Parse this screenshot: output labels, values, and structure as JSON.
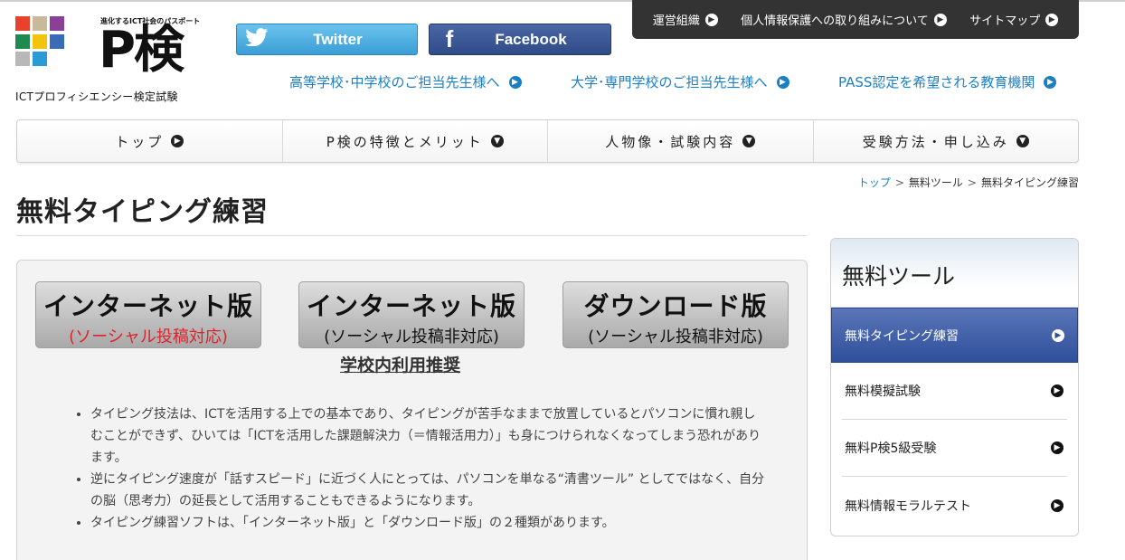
{
  "logo": {
    "tagline": "進化するICT社会のパスポート",
    "main": "P検",
    "subtitle": "ICTプロフィシエンシー検定試験",
    "mosaic_colors": [
      "#e8432a",
      "#c9b99a",
      "#8b3f96",
      "#1e8a4f",
      "#f2c40f",
      "#3a6bb5",
      "#b8b8b8",
      "#2a9bd6",
      "#ffffff"
    ]
  },
  "social": {
    "twitter": "Twitter",
    "facebook": "Facebook"
  },
  "utility_nav": [
    {
      "label": "運営組織"
    },
    {
      "label": "個人情報保護への取り組みについて"
    },
    {
      "label": "サイトマップ"
    }
  ],
  "teacher_links": [
    {
      "label": "高等学校･中学校のご担当先生様へ"
    },
    {
      "label": "大学･専門学校のご担当先生様へ"
    },
    {
      "label": "PASS認定を希望される教育機関"
    }
  ],
  "main_nav": [
    {
      "label": "トップ"
    },
    {
      "label": "P検の特徴とメリット"
    },
    {
      "label": "人物像・試験内容"
    },
    {
      "label": "受験方法・申し込み"
    }
  ],
  "breadcrumb": {
    "home": "トップ",
    "section": "無料ツール",
    "current": "無料タイピング練習",
    "separator": ">"
  },
  "page": {
    "title": "無料タイピング練習"
  },
  "versions": [
    {
      "line1": "インターネット版",
      "line2": "(ソーシャル投稿対応)",
      "line2_color": "#e0222a"
    },
    {
      "line1": "インターネット版",
      "line2": "(ソーシャル投稿非対応)",
      "line2_color": "#111111"
    },
    {
      "line1": "ダウンロード版",
      "line2": "(ソーシャル投稿非対応)",
      "line2_color": "#111111"
    }
  ],
  "recommend": "学校内利用推奨",
  "bullets": [
    "タイピング技法は、ICTを活用する上での基本であり、タイピングが苦手なままで放置しているとパソコンに慣れ親しむことができず、ひいては「ICTを活用した課題解決力（＝情報活用力）」も身につけられなくなってしまう恐れがあります。",
    "逆にタイピング速度が「話すスピード」に近づく人にとっては、パソコンを単なる“清書ツール” としてではなく、自分の脳（思考力）の延長として活用することもできるようになります。",
    "タイピング練習ソフトは、「インターネット版」と「ダウンロード版」の２種類があります。"
  ],
  "sidebar": {
    "title": "無料ツール",
    "items": [
      {
        "label": "無料タイピング練習",
        "active": true
      },
      {
        "label": "無料模擬試験",
        "active": false
      },
      {
        "label": "無料P検5級受験",
        "active": false
      },
      {
        "label": "無料情報モラルテスト",
        "active": false
      }
    ]
  },
  "colors": {
    "link_blue": "#1b7fc4",
    "sidebar_active": "#2e4f9b",
    "utility_bg": "#333333"
  }
}
